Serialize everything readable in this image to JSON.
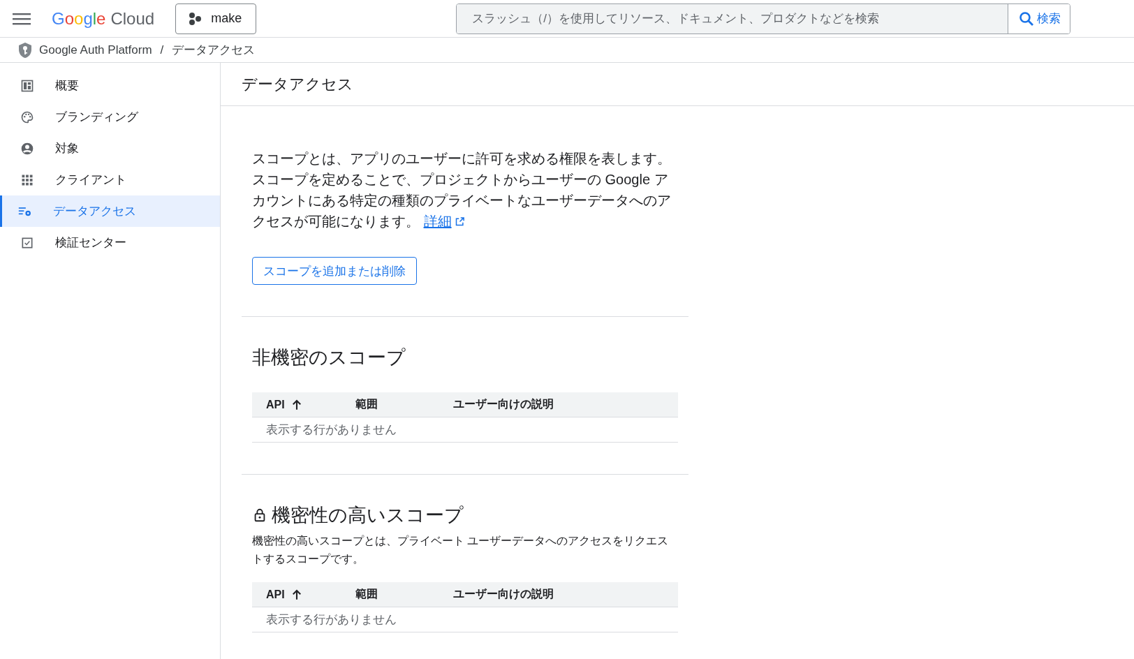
{
  "header": {
    "logo_word": "Google",
    "logo_product": "Cloud",
    "project": "make",
    "search": {
      "placeholder": "スラッシュ（/）を使用してリソース、ドキュメント、プロダクトなどを検索"
    },
    "search_button": "検索"
  },
  "breadcrumb": {
    "items": [
      "Google Auth Platform",
      "データアクセス"
    ],
    "separator": "/"
  },
  "sidebar": {
    "items": [
      {
        "label": "概要",
        "selected": false
      },
      {
        "label": "ブランディング",
        "selected": false
      },
      {
        "label": "対象",
        "selected": false
      },
      {
        "label": "クライアント",
        "selected": false
      },
      {
        "label": "データアクセス",
        "selected": true
      },
      {
        "label": "検証センター",
        "selected": false
      }
    ]
  },
  "page_title": "データアクセス",
  "intro": {
    "text": "スコープとは、アプリのユーザーに許可を求める権限を表します。スコープを定めることで、プロジェクトからユーザーの Google アカウントにある特定の種類のプライベートなユーザーデータへのアクセスが可能になります。",
    "link": "詳細"
  },
  "add_button": "スコープを追加または削除",
  "sections": [
    {
      "title": "非機密のスコープ",
      "locked": false,
      "columns": [
        {
          "label": "API",
          "sorted": true
        },
        {
          "label": "範囲",
          "sorted": false
        },
        {
          "label": "ユーザー向けの説明",
          "sorted": false
        }
      ],
      "empty_text": "表示する行がありません"
    },
    {
      "title": "機密性の高いスコープ",
      "locked": true,
      "description": "機密性の高いスコープとは、プライベート ユーザーデータへのアクセスをリクエストするスコープです。",
      "columns": [
        {
          "label": "API",
          "sorted": true
        },
        {
          "label": "範囲",
          "sorted": false
        },
        {
          "label": "ユーザー向けの説明",
          "sorted": false
        }
      ],
      "empty_text": "表示する行がありません"
    }
  ]
}
